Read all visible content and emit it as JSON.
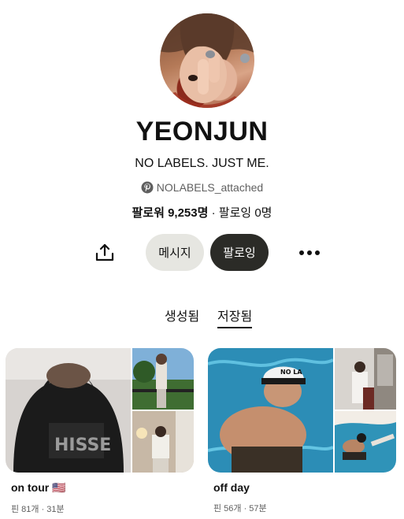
{
  "profile": {
    "name": "YEONJUN",
    "bio": "NO LABELS. JUST ME.",
    "handle": "NOLABELS_attached",
    "followers_label": "팔로워",
    "followers_count": "9,253명",
    "separator": " · ",
    "following_text": "팔로잉 0명"
  },
  "actions": {
    "share_icon": "share-icon",
    "message_label": "메시지",
    "follow_label": "팔로잉",
    "more_icon": "more-icon"
  },
  "tabs": [
    {
      "label": "생성됨",
      "active": false
    },
    {
      "label": "저장됨",
      "active": true
    }
  ],
  "boards": [
    {
      "title": "on tour 🇺🇸",
      "meta": "핀 81개 · 31분"
    },
    {
      "title": "off day",
      "meta": "핀 56개 · 57분"
    }
  ],
  "colors": {
    "message_bg": "#e6e6e1",
    "follow_bg": "#2b2b27",
    "secondary_text": "#5f5f5f"
  }
}
